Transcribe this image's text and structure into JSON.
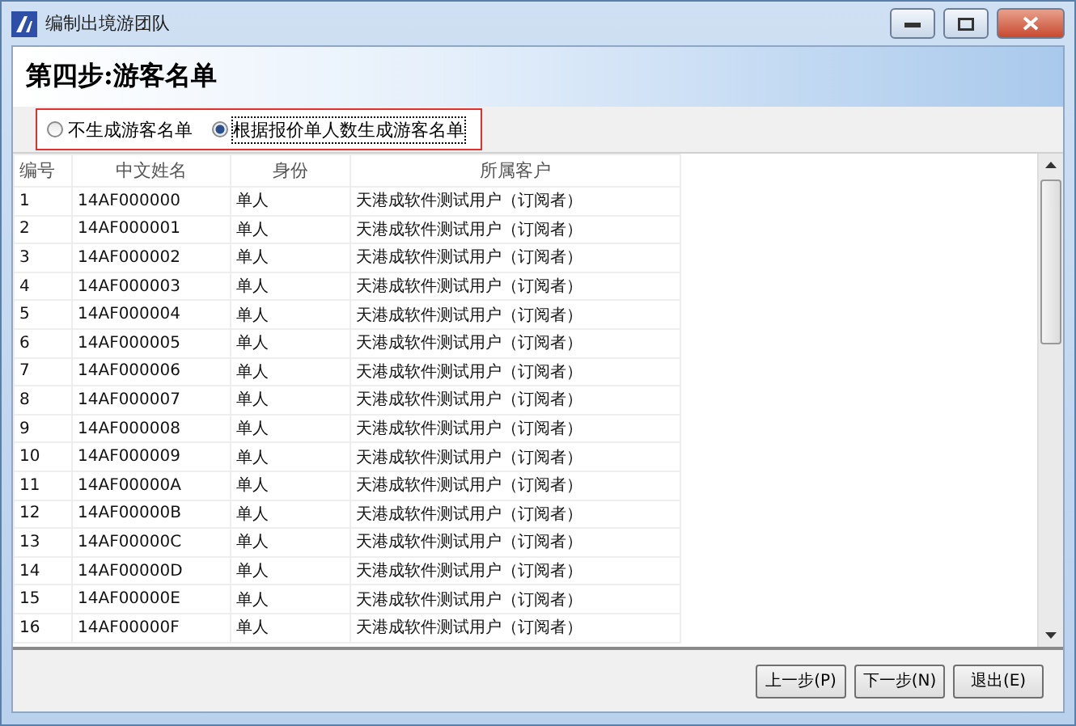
{
  "window": {
    "title": "编制出境游团队"
  },
  "step_title": "第四步:游客名单",
  "options": [
    {
      "label": "不生成游客名单",
      "selected": false
    },
    {
      "label": "根据报价单人数生成游客名单",
      "selected": true
    }
  ],
  "table": {
    "columns": [
      "编号",
      "中文姓名",
      "身份",
      "所属客户"
    ],
    "rows": [
      [
        "1",
        "14AF000000",
        "单人",
        "天港成软件测试用户（订阅者）"
      ],
      [
        "2",
        "14AF000001",
        "单人",
        "天港成软件测试用户（订阅者）"
      ],
      [
        "3",
        "14AF000002",
        "单人",
        "天港成软件测试用户（订阅者）"
      ],
      [
        "4",
        "14AF000003",
        "单人",
        "天港成软件测试用户（订阅者）"
      ],
      [
        "5",
        "14AF000004",
        "单人",
        "天港成软件测试用户（订阅者）"
      ],
      [
        "6",
        "14AF000005",
        "单人",
        "天港成软件测试用户（订阅者）"
      ],
      [
        "7",
        "14AF000006",
        "单人",
        "天港成软件测试用户（订阅者）"
      ],
      [
        "8",
        "14AF000007",
        "单人",
        "天港成软件测试用户（订阅者）"
      ],
      [
        "9",
        "14AF000008",
        "单人",
        "天港成软件测试用户（订阅者）"
      ],
      [
        "10",
        "14AF000009",
        "单人",
        "天港成软件测试用户（订阅者）"
      ],
      [
        "11",
        "14AF00000A",
        "单人",
        "天港成软件测试用户（订阅者）"
      ],
      [
        "12",
        "14AF00000B",
        "单人",
        "天港成软件测试用户（订阅者）"
      ],
      [
        "13",
        "14AF00000C",
        "单人",
        "天港成软件测试用户（订阅者）"
      ],
      [
        "14",
        "14AF00000D",
        "单人",
        "天港成软件测试用户（订阅者）"
      ],
      [
        "15",
        "14AF00000E",
        "单人",
        "天港成软件测试用户（订阅者）"
      ],
      [
        "16",
        "14AF00000F",
        "单人",
        "天港成软件测试用户（订阅者）"
      ]
    ]
  },
  "buttons": [
    "上一步(P)",
    "下一步(N)",
    "退出(E)"
  ]
}
